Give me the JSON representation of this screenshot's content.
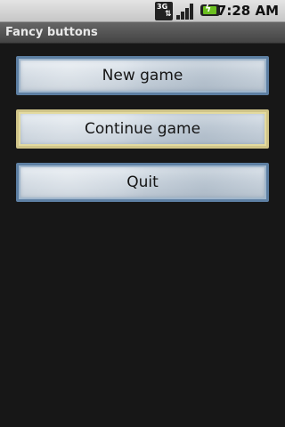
{
  "status_bar": {
    "network_label": "3G",
    "time": "7:28 AM",
    "icons": [
      "3g-data-icon",
      "signal-strength-icon",
      "battery-charging-icon"
    ]
  },
  "title_bar": {
    "title": "Fancy buttons"
  },
  "buttons": [
    {
      "label": "New game"
    },
    {
      "label": "Continue game",
      "state": "focused"
    },
    {
      "label": "Quit"
    }
  ],
  "colors": {
    "background": "#171717",
    "button_border": "#5d7fa2",
    "focused_border": "#cfc489",
    "battery": "#6bc020"
  }
}
